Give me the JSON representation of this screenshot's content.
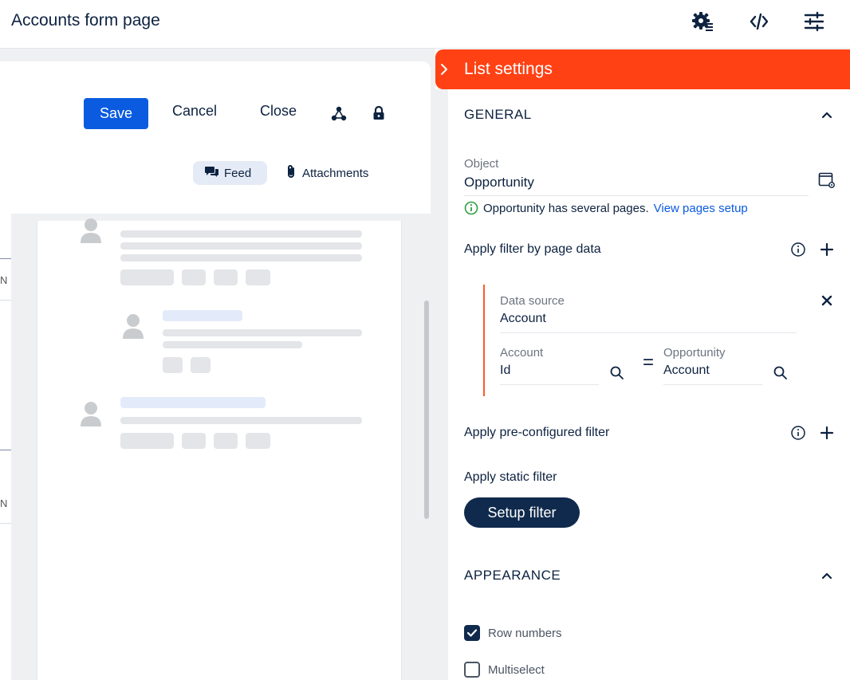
{
  "page": {
    "title": "Accounts form page"
  },
  "topbar": {
    "icons": [
      "settings-gear-icon",
      "code-icon",
      "sliders-icon"
    ]
  },
  "form": {
    "save_label": "Save",
    "cancel_label": "Cancel",
    "close_label": "Close",
    "tabs": [
      {
        "label": "Feed",
        "active": true
      },
      {
        "label": "Attachments",
        "active": false
      }
    ]
  },
  "list_settings": {
    "title": "List settings",
    "general": {
      "title": "GENERAL",
      "object_label": "Object",
      "object_value": "Opportunity",
      "info_text": "Opportunity has several pages.",
      "info_link": "View pages setup",
      "apply_filter_by_page_data": "Apply filter by page data",
      "filter": {
        "data_source_label": "Data source",
        "data_source_value": "Account",
        "left_label": "Account",
        "left_value": "Id",
        "equals": "=",
        "right_label": "Opportunity",
        "right_value": "Account"
      },
      "apply_preconfigured_filter": "Apply pre-configured filter",
      "apply_static_filter": "Apply static filter",
      "setup_filter_label": "Setup filter"
    },
    "appearance": {
      "title": "APPEARANCE",
      "options": [
        {
          "label": "Row numbers",
          "checked": true
        },
        {
          "label": "Multiselect",
          "checked": false
        }
      ]
    }
  },
  "left_strip": {
    "chars": [
      "N",
      "N"
    ]
  },
  "colors": {
    "accent_orange": "#ff4114",
    "primary_blue": "#0a5be0",
    "navy": "#0f2a4d",
    "link_blue": "#0a5be0",
    "success_green": "#2e9e3f"
  }
}
